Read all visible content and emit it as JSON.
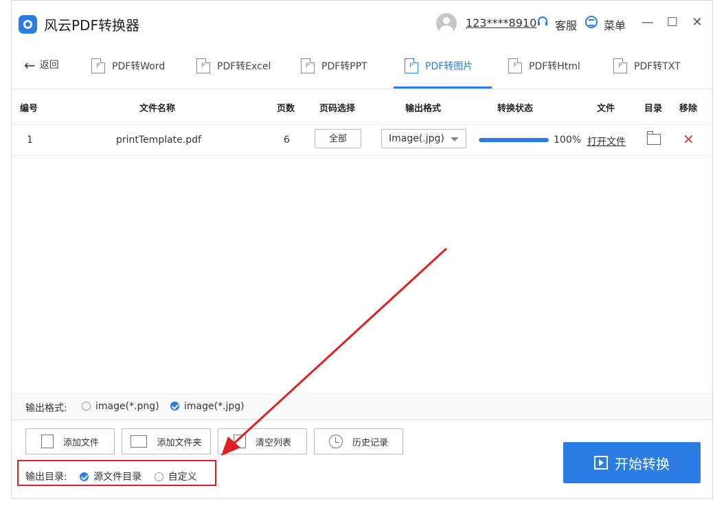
{
  "app": {
    "title": "风云PDF转换器",
    "user": "123****8910",
    "service": "客服",
    "menu": "菜单"
  },
  "window_controls": {
    "minimize": "—",
    "maximize": "☐",
    "close": "✕"
  },
  "nav": {
    "back_label": "返回"
  },
  "tabs": [
    {
      "label": "PDF转Word",
      "active": false
    },
    {
      "label": "PDF转Excel",
      "active": false
    },
    {
      "label": "PDF转PPT",
      "active": false
    },
    {
      "label": "PDF转图片",
      "active": true
    },
    {
      "label": "PDF转Html",
      "active": false
    },
    {
      "label": "PDF转TXT",
      "active": false
    }
  ],
  "table": {
    "headers": {
      "index": "编号",
      "filename": "文件名称",
      "pages": "页数",
      "page_select": "页码选择",
      "output_format": "输出格式",
      "status": "转换状态",
      "file": "文件",
      "dir": "目录",
      "remove": "移除"
    },
    "rows": [
      {
        "index": "1",
        "filename": "printTemplate.pdf",
        "pages": "6",
        "page_select": "全部",
        "format": "Image(.jpg)",
        "progress_percent": 100,
        "progress_text": "100%",
        "file_link": "打开文件"
      }
    ]
  },
  "output_format": {
    "label": "输出格式:",
    "options": [
      {
        "label": "image(*.png)",
        "checked": false
      },
      {
        "label": "image(*.jpg)",
        "checked": true
      }
    ]
  },
  "actions": {
    "add_file": "添加文件",
    "add_folder": "添加文件夹",
    "clear_list": "清空列表",
    "history": "历史记录"
  },
  "output_dir": {
    "label": "输出目录:",
    "options": [
      {
        "label": "源文件目录",
        "checked": true
      },
      {
        "label": "自定义",
        "checked": false
      }
    ]
  },
  "start_button": "开始转换",
  "colors": {
    "accent": "#2a7de1",
    "annotation": "#e02020",
    "remove": "#e23b3b"
  }
}
